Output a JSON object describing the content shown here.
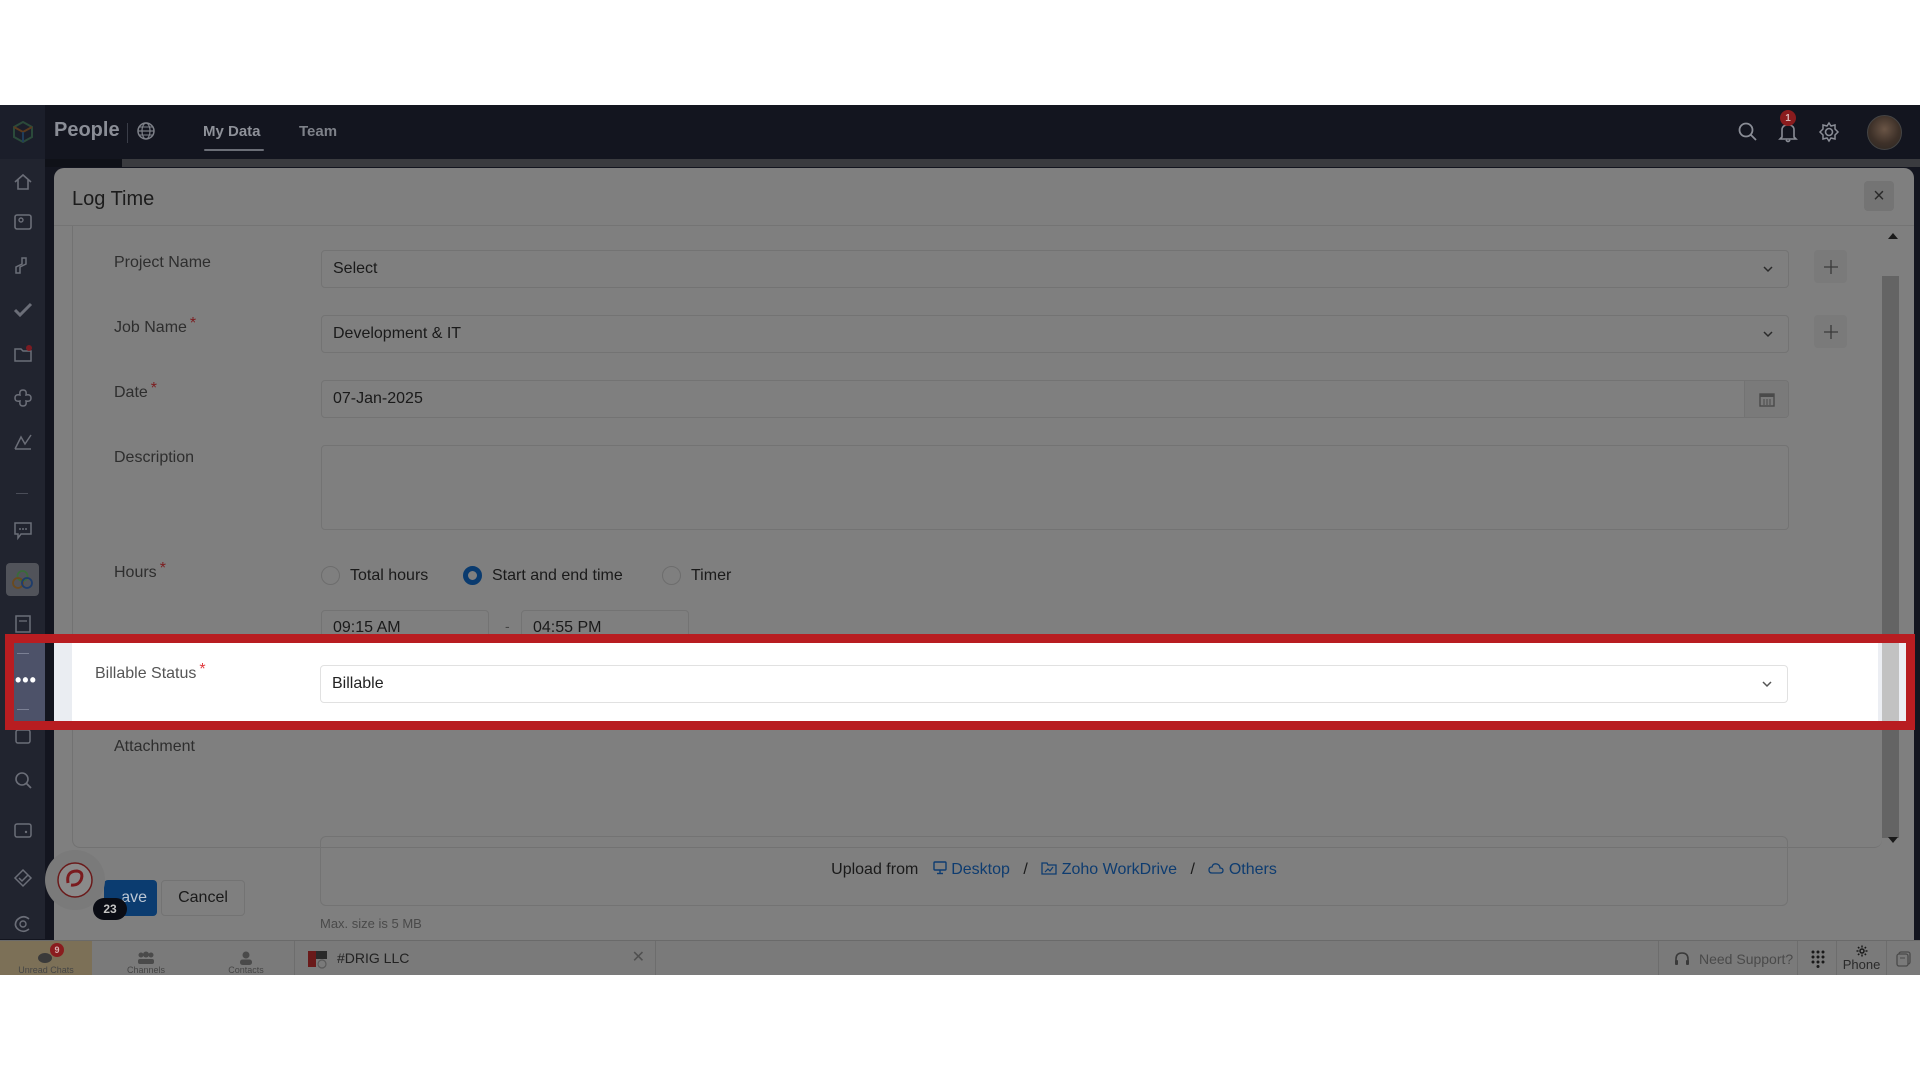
{
  "topbar": {
    "app_name": "People",
    "tabs": [
      {
        "label": "My Data",
        "active": true
      },
      {
        "label": "Team",
        "active": false
      }
    ],
    "notification_count": "1"
  },
  "sidebar": {
    "items": [
      "home-icon",
      "profile-card-icon",
      "leave-icon",
      "approvals-icon",
      "files-icon",
      "org-icon",
      "performance-icon",
      "feedback-icon",
      "apps-icon",
      "forms-icon",
      "more-icon",
      "tasks-icon",
      "search-icon",
      "wallet-icon",
      "check-icon",
      "cases-icon"
    ],
    "more_label": "•••"
  },
  "modal": {
    "title": "Log Time",
    "close": "×",
    "fields": {
      "project": {
        "label": "Project Name",
        "required": false,
        "value": "Select"
      },
      "job": {
        "label": "Job Name",
        "required": true,
        "value": "Development & IT"
      },
      "date": {
        "label": "Date",
        "required": true,
        "value": "07-Jan-2025"
      },
      "description": {
        "label": "Description",
        "required": false,
        "value": ""
      },
      "hours": {
        "label": "Hours",
        "required": true,
        "options": [
          "Total hours",
          "Start and end time",
          "Timer"
        ],
        "selected": "Start and end time",
        "start_time": "09:15 AM",
        "separator": "-",
        "end_time": "04:55 PM"
      },
      "billable": {
        "label": "Billable Status",
        "required": true,
        "value": "Billable"
      },
      "attachment": {
        "label": "Attachment",
        "upload_prefix": "Upload from",
        "sources": [
          "Desktop",
          "Zoho WorkDrive",
          "Others"
        ],
        "separator": "/",
        "hint": "Max. size is 5 MB"
      }
    },
    "required_mark": "*",
    "save_label": "Save",
    "cancel_label": "Cancel"
  },
  "chat": {
    "bubble_count": "23",
    "tabs": [
      {
        "label": "Unread Chats",
        "badge": "9",
        "active": true
      },
      {
        "label": "Channels",
        "active": false
      },
      {
        "label": "Contacts",
        "active": false
      }
    ],
    "conversation": "#DRIG LLC",
    "support_label": "Need Support?",
    "phone_label": "Phone"
  },
  "colors": {
    "highlight": "#b81d21",
    "accent": "#0b3c70",
    "required": "#e03a3e"
  }
}
